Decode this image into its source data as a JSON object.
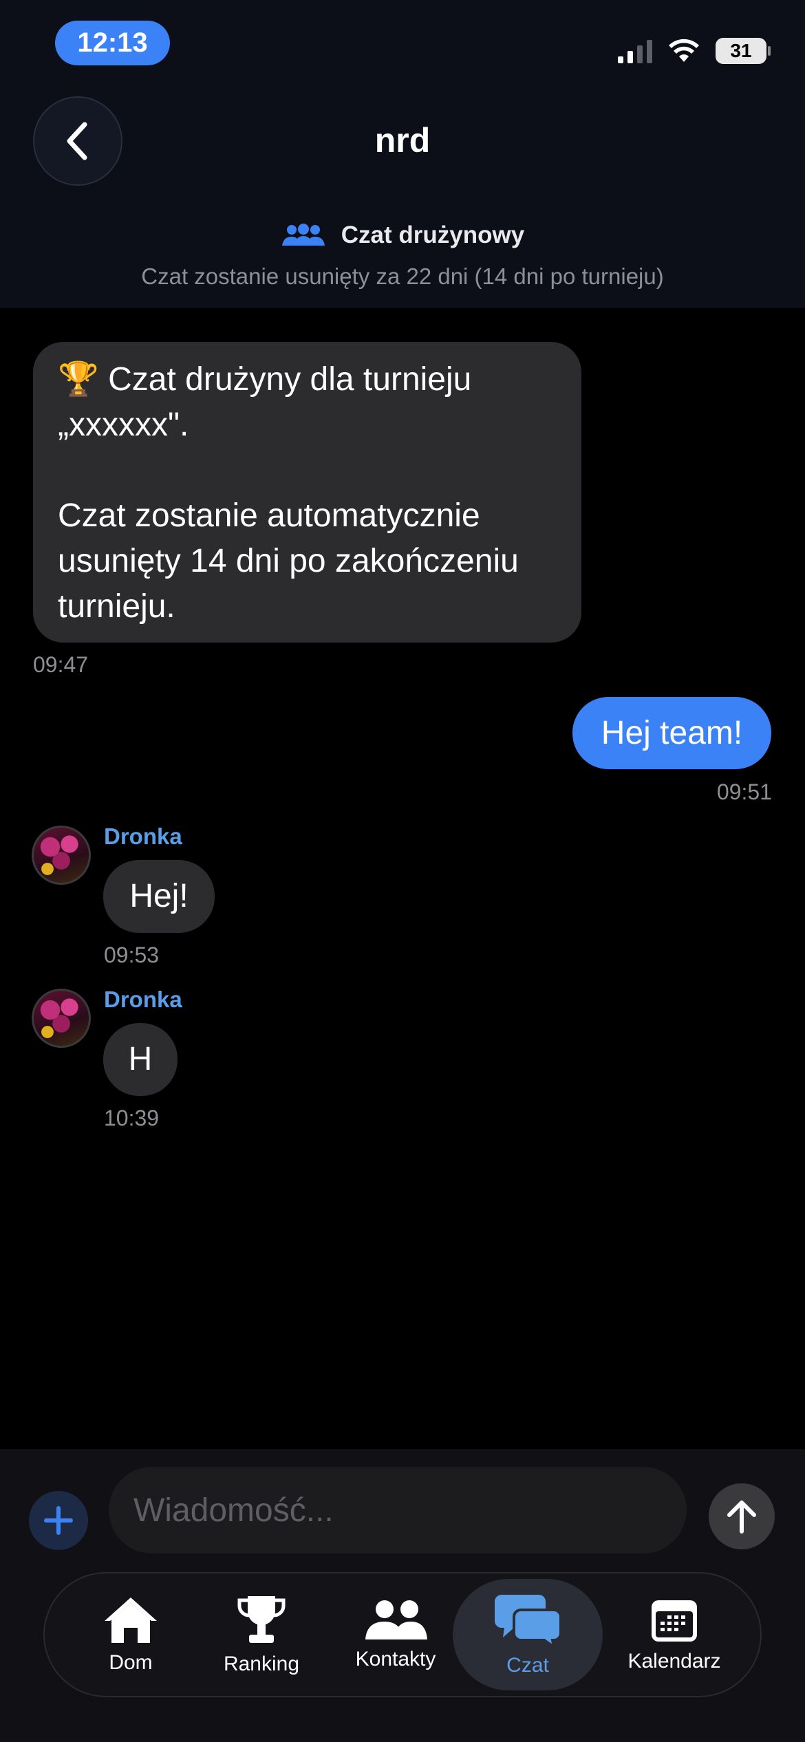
{
  "status_bar": {
    "time": "12:13",
    "battery": "31"
  },
  "header": {
    "title": "nrd",
    "team_label": "Czat drużynowy",
    "subtitle": "Czat zostanie usunięty za 22 dni (14 dni po turnieju)"
  },
  "messages": [
    {
      "type": "system",
      "text": "🏆 Czat drużyny dla turnieju „xxxxxx\".\n\nCzat zostanie automatycznie usunięty 14 dni po zakończeniu turnieju.",
      "time": "09:47"
    },
    {
      "type": "outgoing",
      "text": "Hej team!",
      "time": "09:51"
    },
    {
      "type": "incoming",
      "sender": "Dronka",
      "text": "Hej!",
      "time": "09:53"
    },
    {
      "type": "incoming",
      "sender": "Dronka",
      "text": "H",
      "time": "10:39"
    }
  ],
  "composer": {
    "placeholder": "Wiadomość..."
  },
  "tabs": [
    {
      "label": "Dom",
      "icon": "home-icon"
    },
    {
      "label": "Ranking",
      "icon": "trophy-icon"
    },
    {
      "label": "Kontakty",
      "icon": "contacts-icon"
    },
    {
      "label": "Czat",
      "icon": "chat-icon",
      "active": true
    },
    {
      "label": "Kalendarz",
      "icon": "calendar-icon"
    }
  ],
  "colors": {
    "accent": "#3b82f6",
    "sender": "#5b9ee8",
    "bubble": "#2c2c2e",
    "header_bg": "#0c0f18"
  }
}
